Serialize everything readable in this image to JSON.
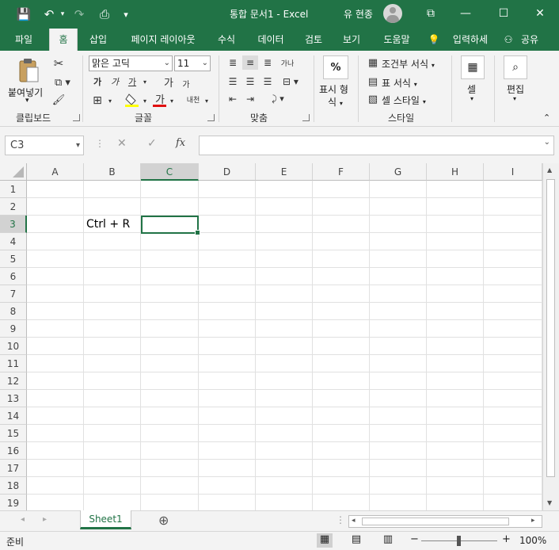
{
  "window": {
    "title": "통합 문서1  -  Excel",
    "user_name": "유 현종",
    "restore_symbol": "⧉",
    "minimize_symbol": "—",
    "maximize_symbol": "☐",
    "close_symbol": "✕"
  },
  "qat": {
    "save": "💾",
    "undo": "↶",
    "redo": "↷",
    "print": "⎙",
    "customize": "▾"
  },
  "tabs": [
    "파일",
    "홈",
    "삽입",
    "페이지 레이아웃",
    "수식",
    "데이터",
    "검토",
    "보기",
    "도움말"
  ],
  "active_tab": "홈",
  "tell_me": "입력하세",
  "share": "공유",
  "ribbon": {
    "clipboard": {
      "label": "클립보드",
      "paste": "붙여넣기"
    },
    "font": {
      "label": "글꼴",
      "font_name": "맑은 고딕",
      "font_size": "11",
      "bold": "가",
      "italic": "가",
      "underline": "가",
      "grow": "가",
      "shrink": "가",
      "font_color": "가",
      "phonetic": "내천"
    },
    "alignment": {
      "label": "맞춤",
      "wrap": "가나"
    },
    "number": {
      "label": "표시 형식",
      "label_line1": "표시 형",
      "label_line2": "식",
      "percent": "%"
    },
    "styles": {
      "label": "스타일",
      "conditional": "조건부 서식",
      "table": "표 서식",
      "cell_style": "셀 스타일"
    },
    "cells": {
      "label": "셀"
    },
    "editing": {
      "label": "편집"
    }
  },
  "formula_bar": {
    "name_box": "C3",
    "cancel": "✕",
    "enter": "✓",
    "fx": "fx",
    "value": ""
  },
  "columns": [
    "A",
    "B",
    "C",
    "D",
    "E",
    "F",
    "G",
    "H",
    "I"
  ],
  "rows": [
    "1",
    "2",
    "3",
    "4",
    "5",
    "6",
    "7",
    "8",
    "9",
    "10",
    "11",
    "12",
    "13",
    "14",
    "15",
    "16",
    "17",
    "18",
    "19"
  ],
  "selected_column": "C",
  "selected_row": "3",
  "cells": {
    "B3": "Ctrl + R"
  },
  "sheets": [
    "Sheet1"
  ],
  "add_sheet": "⊕",
  "status": {
    "ready": "준비",
    "zoom": "100%",
    "zoom_minus": "−",
    "zoom_plus": "+"
  },
  "colors": {
    "accent": "#217346",
    "font_color_bar": "#e01010",
    "highlight_bar": "#ffff00"
  }
}
